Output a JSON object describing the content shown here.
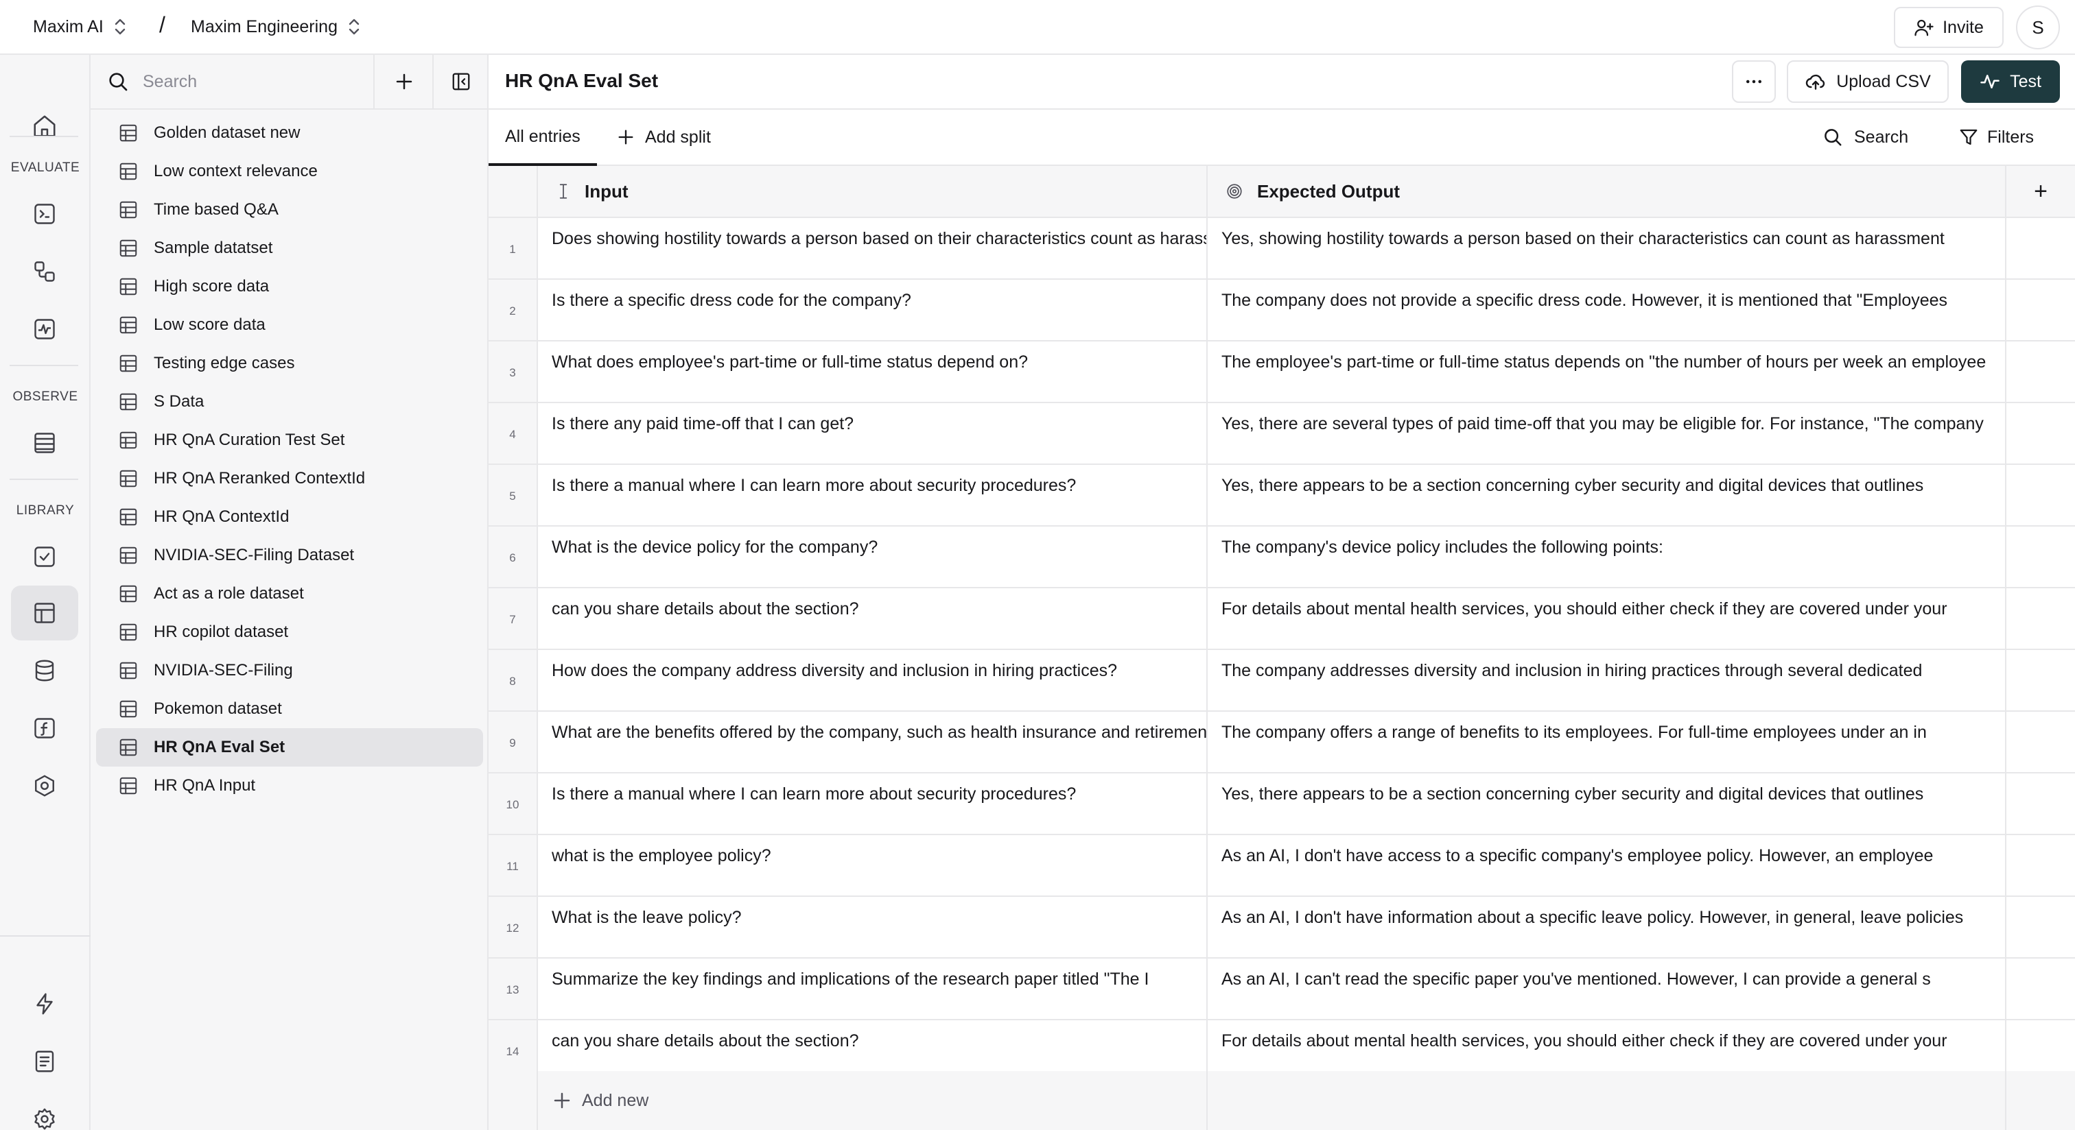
{
  "topbar": {
    "org": "Maxim AI",
    "separator": "/",
    "workspace": "Maxim Engineering",
    "invite_label": "Invite",
    "avatar_initial": "S"
  },
  "rail": {
    "sections": {
      "evaluate": "EVALUATE",
      "observe": "OBSERVE",
      "library": "LIBRARY"
    },
    "icons": [
      "home-icon",
      "prompt-icon",
      "workflow-icon",
      "activity-icon",
      "logs-icon",
      "evaluators-icon",
      "datasets-icon",
      "context-sources-icon",
      "functions-icon",
      "prompt-tools-icon",
      "bolt-icon",
      "docs-icon",
      "settings-icon"
    ]
  },
  "sidebar": {
    "search_placeholder": "Search",
    "datasets": [
      {
        "label": "Golden dataset new"
      },
      {
        "label": "Low context relevance"
      },
      {
        "label": "Time based Q&A"
      },
      {
        "label": "Sample datatset"
      },
      {
        "label": "High score data"
      },
      {
        "label": "Low score data"
      },
      {
        "label": "Testing edge cases"
      },
      {
        "label": "S Data"
      },
      {
        "label": "HR QnA Curation Test Set"
      },
      {
        "label": "HR QnA Reranked ContextId"
      },
      {
        "label": "HR QnA ContextId"
      },
      {
        "label": "NVIDIA-SEC-Filing Dataset"
      },
      {
        "label": "Act as a role dataset"
      },
      {
        "label": "HR copilot dataset"
      },
      {
        "label": "NVIDIA-SEC-Filing"
      },
      {
        "label": "Pokemon dataset"
      },
      {
        "label": "HR QnA Eval Set"
      },
      {
        "label": "HR QnA Input"
      }
    ],
    "active_index": 16
  },
  "main": {
    "title": "HR QnA Eval Set",
    "upload_label": "Upload CSV",
    "test_label": "Test",
    "tabs": {
      "all_entries": "All entries",
      "add_split": "Add split"
    },
    "search_label": "Search",
    "filters_label": "Filters"
  },
  "table": {
    "columns": {
      "input": "Input",
      "expected_output": "Expected Output",
      "add": "+"
    },
    "rows": [
      {
        "n": "1",
        "input": "Does showing hostility towards a person based on their characteristics count as harassment?",
        "output": "Yes, showing hostility towards a person based on their characteristics can count as harassment"
      },
      {
        "n": "2",
        "input": "Is there a specific dress code for the company?",
        "output": "The company does not provide a specific dress code. However, it is mentioned that \"Employees"
      },
      {
        "n": "3",
        "input": "What does employee's part-time or full-time status depend on?",
        "output": "The employee's part-time or full-time status depends on \"the number of hours per week an employee"
      },
      {
        "n": "4",
        "input": "Is there any paid time-off that I can get?",
        "output": "Yes, there are several types of paid time-off that you may be eligible for. For instance, \"The company"
      },
      {
        "n": "5",
        "input": "Is there a manual where I can learn more about security procedures?",
        "output": "Yes, there appears to be a section concerning cyber security and digital devices that outlines"
      },
      {
        "n": "6",
        "input": "What is the device policy for the company?",
        "output": "The company's device policy includes the following points:"
      },
      {
        "n": "7",
        "input": "can you share details about the section?",
        "output": "For details about mental health services, you should either check if they are covered under your"
      },
      {
        "n": "8",
        "input": "How does the company address diversity and inclusion in hiring practices?",
        "output": "The company addresses diversity and inclusion in hiring practices through several dedicated"
      },
      {
        "n": "9",
        "input": "What are the benefits offered by the company, such as health insurance and retirement plans?",
        "output": "The company offers a range of benefits to its employees. For full-time employees under an in"
      },
      {
        "n": "10",
        "input": "Is there a manual where I can learn more about security procedures?",
        "output": "Yes, there appears to be a section concerning cyber security and digital devices that outlines"
      },
      {
        "n": "11",
        "input": "what is the employee policy?",
        "output": "As an AI, I don't have access to a specific company's employee policy. However, an employee"
      },
      {
        "n": "12",
        "input": "What is the leave policy?",
        "output": "As an AI, I don't have information about a specific leave policy. However, in general, leave policies"
      },
      {
        "n": "13",
        "input": "Summarize the key findings and implications of the research paper titled \"The I",
        "output": "As an AI, I can't read the specific paper you've mentioned. However, I can provide a general s"
      },
      {
        "n": "14",
        "input": "can you share details about the section?",
        "output": "For details about mental health services, you should either check if they are covered under your"
      }
    ],
    "add_new_label": "Add new"
  }
}
